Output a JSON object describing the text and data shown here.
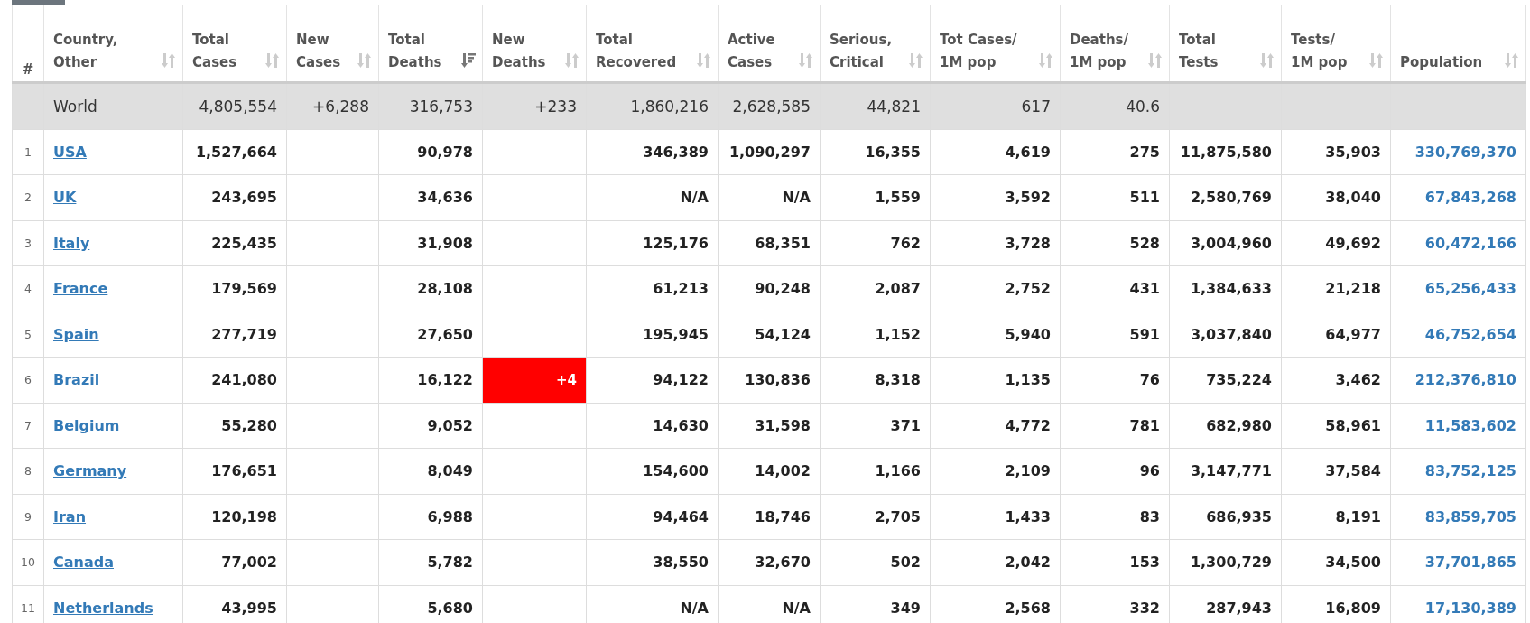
{
  "columns": [
    {
      "label": "#",
      "sortable": false
    },
    {
      "label": "Country,\nOther",
      "sortable": true,
      "sorted": false
    },
    {
      "label": "Total\nCases",
      "sortable": true,
      "sorted": false
    },
    {
      "label": "New\nCases",
      "sortable": true,
      "sorted": false
    },
    {
      "label": "Total\nDeaths",
      "sortable": true,
      "sorted": true
    },
    {
      "label": "New\nDeaths",
      "sortable": true,
      "sorted": false
    },
    {
      "label": "Total\nRecovered",
      "sortable": true,
      "sorted": false
    },
    {
      "label": "Active\nCases",
      "sortable": true,
      "sorted": false
    },
    {
      "label": "Serious,\nCritical",
      "sortable": true,
      "sorted": false
    },
    {
      "label": "Tot Cases/\n1M pop",
      "sortable": true,
      "sorted": false
    },
    {
      "label": "Deaths/\n1M pop",
      "sortable": true,
      "sorted": false
    },
    {
      "label": "Total\nTests",
      "sortable": true,
      "sorted": false
    },
    {
      "label": "Tests/\n1M pop",
      "sortable": true,
      "sorted": false
    },
    {
      "label": "Population",
      "sortable": true,
      "sorted": false
    }
  ],
  "world": {
    "country": "World",
    "cells": [
      "4,805,554",
      "+6,288",
      "316,753",
      "+233",
      "1,860,216",
      "2,628,585",
      "44,821",
      "617",
      "40.6",
      null,
      null,
      null
    ]
  },
  "rows": [
    {
      "rank": "1",
      "country": "USA",
      "new_deaths_alert": false,
      "cells": [
        "1,527,664",
        null,
        "90,978",
        null,
        "346,389",
        "1,090,297",
        "16,355",
        "4,619",
        "275",
        "11,875,580",
        "35,903",
        "330,769,370"
      ]
    },
    {
      "rank": "2",
      "country": "UK",
      "new_deaths_alert": false,
      "cells": [
        "243,695",
        null,
        "34,636",
        null,
        "N/A",
        "N/A",
        "1,559",
        "3,592",
        "511",
        "2,580,769",
        "38,040",
        "67,843,268"
      ]
    },
    {
      "rank": "3",
      "country": "Italy",
      "new_deaths_alert": false,
      "cells": [
        "225,435",
        null,
        "31,908",
        null,
        "125,176",
        "68,351",
        "762",
        "3,728",
        "528",
        "3,004,960",
        "49,692",
        "60,472,166"
      ]
    },
    {
      "rank": "4",
      "country": "France",
      "new_deaths_alert": false,
      "cells": [
        "179,569",
        null,
        "28,108",
        null,
        "61,213",
        "90,248",
        "2,087",
        "2,752",
        "431",
        "1,384,633",
        "21,218",
        "65,256,433"
      ]
    },
    {
      "rank": "5",
      "country": "Spain",
      "new_deaths_alert": false,
      "cells": [
        "277,719",
        null,
        "27,650",
        null,
        "195,945",
        "54,124",
        "1,152",
        "5,940",
        "591",
        "3,037,840",
        "64,977",
        "46,752,654"
      ]
    },
    {
      "rank": "6",
      "country": "Brazil",
      "new_deaths_alert": true,
      "cells": [
        "241,080",
        null,
        "16,122",
        "+4",
        "94,122",
        "130,836",
        "8,318",
        "1,135",
        "76",
        "735,224",
        "3,462",
        "212,376,810"
      ]
    },
    {
      "rank": "7",
      "country": "Belgium",
      "new_deaths_alert": false,
      "cells": [
        "55,280",
        null,
        "9,052",
        null,
        "14,630",
        "31,598",
        "371",
        "4,772",
        "781",
        "682,980",
        "58,961",
        "11,583,602"
      ]
    },
    {
      "rank": "8",
      "country": "Germany",
      "new_deaths_alert": false,
      "cells": [
        "176,651",
        null,
        "8,049",
        null,
        "154,600",
        "14,002",
        "1,166",
        "2,109",
        "96",
        "3,147,771",
        "37,584",
        "83,752,125"
      ]
    },
    {
      "rank": "9",
      "country": "Iran",
      "new_deaths_alert": false,
      "cells": [
        "120,198",
        null,
        "6,988",
        null,
        "94,464",
        "18,746",
        "2,705",
        "1,433",
        "83",
        "686,935",
        "8,191",
        "83,859,705"
      ]
    },
    {
      "rank": "10",
      "country": "Canada",
      "new_deaths_alert": false,
      "cells": [
        "77,002",
        null,
        "5,782",
        null,
        "38,550",
        "32,670",
        "502",
        "2,042",
        "153",
        "1,300,729",
        "34,500",
        "37,701,865"
      ]
    },
    {
      "rank": "11",
      "country": "Netherlands",
      "new_deaths_alert": false,
      "cells": [
        "43,995",
        null,
        "5,680",
        null,
        "N/A",
        "N/A",
        "349",
        "2,568",
        "332",
        "287,943",
        "16,809",
        "17,130,389"
      ]
    }
  ]
}
